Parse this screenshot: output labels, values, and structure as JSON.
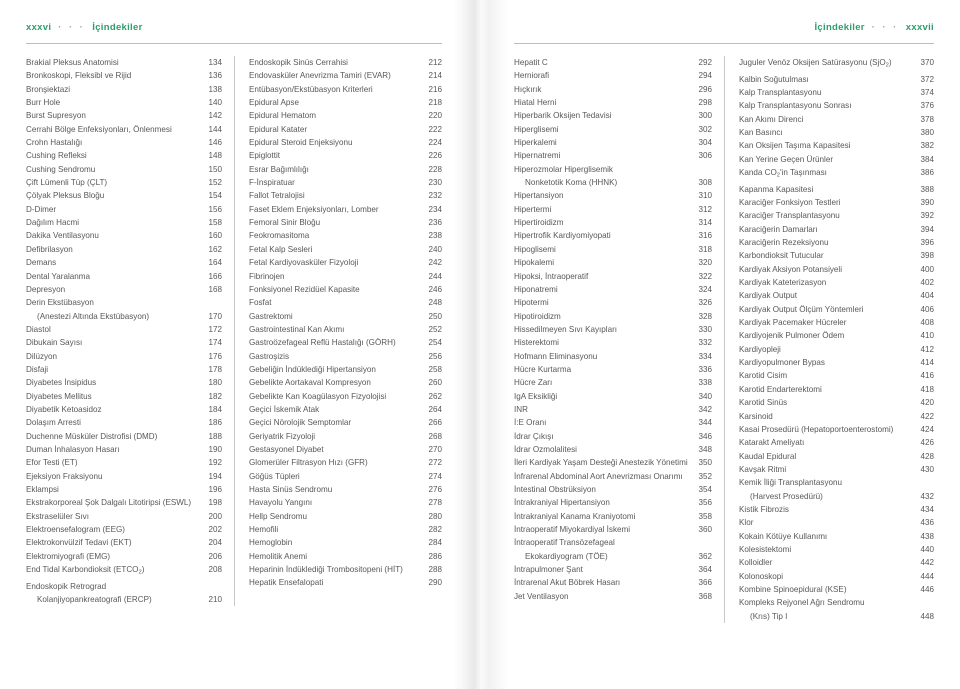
{
  "left_page": {
    "running_head": {
      "folio": "xxxvi",
      "dots": "· · ·",
      "title": "İçindekiler"
    },
    "columns": [
      {
        "entries": [
          {
            "title": "Brakial Pleksus Anatomisi",
            "page": "134"
          },
          {
            "title": "Bronkoskopi, Fleksibl ve Rijid",
            "page": "136"
          },
          {
            "title": "Bronşiektazi",
            "page": "138"
          },
          {
            "title": "Burr Hole",
            "page": "140"
          },
          {
            "title": "Burst Supresyon",
            "page": "142"
          },
          {
            "title": "Cerrahi Bölge Enfeksiyonları, Önlenmesi",
            "page": "144"
          },
          {
            "title": "Crohn Hastalığı",
            "page": "146"
          },
          {
            "title": "Cushing Refleksi",
            "page": "148"
          },
          {
            "title": "Cushing Sendromu",
            "page": "150"
          },
          {
            "title": "Çift Lümenli Tüp (ÇLT)",
            "page": "152"
          },
          {
            "title": "Çölyak Pleksus Bloğu",
            "page": "154"
          },
          {
            "title": "D-Dimer",
            "page": "156"
          },
          {
            "title": "Dağılım Hacmi",
            "page": "158"
          },
          {
            "title": "Dakika Ventilasyonu",
            "page": "160"
          },
          {
            "title": "Defibrilasyon",
            "page": "162"
          },
          {
            "title": "Demans",
            "page": "164"
          },
          {
            "title": "Dental Yaralanma",
            "page": "166"
          },
          {
            "title": "Depresyon",
            "page": "168"
          },
          {
            "title": "Derin Ekstübasyon",
            "page": "",
            "continued": "head"
          },
          {
            "title": "(Anestezi Altında Ekstübasyon)",
            "page": "170",
            "continued": "tail"
          },
          {
            "title": "Diastol",
            "page": "172"
          },
          {
            "title": "Dibukain Sayısı",
            "page": "174"
          },
          {
            "title": "Dilüzyon",
            "page": "176"
          },
          {
            "title": "Disfaji",
            "page": "178"
          },
          {
            "title": "Diyabetes İnsipidus",
            "page": "180"
          },
          {
            "title": "Diyabetes Mellitus",
            "page": "182"
          },
          {
            "title": "Diyabetik Ketoasidoz",
            "page": "184"
          },
          {
            "title": "Dolaşım Arresti",
            "page": "186"
          },
          {
            "title": "Duchenne Müsküler Distrofisi (DMD)",
            "page": "188"
          },
          {
            "title": "Duman İnhalasyon Hasarı",
            "page": "190"
          },
          {
            "title": "Efor Testi (ET)",
            "page": "192"
          },
          {
            "title": "Ejeksiyon Fraksiyonu",
            "page": "194"
          },
          {
            "title": "Eklampsi",
            "page": "196"
          },
          {
            "title": "Ekstrakorporeal Şok Dalgalı Litotiripsi (ESWL)",
            "page": "198"
          },
          {
            "title": "Ekstraselüler Sıvı",
            "page": "200"
          },
          {
            "title": "Elektroensefalogram (EEG)",
            "page": "202"
          },
          {
            "title": "Elektrokonvülzif Tedavi (EKT)",
            "page": "204"
          },
          {
            "title": "Elektromiyografi (EMG)",
            "page": "206"
          },
          {
            "title": "End Tidal Karbondioksit (ETCO2)",
            "title_html": "End Tidal Karbondioksit (ETCO<sub>2</sub>)",
            "page": "208"
          },
          {
            "title": "Endoskopik Retrograd",
            "page": "",
            "continued": "head"
          },
          {
            "title": "Kolanjiyopankreatografi (ERCP)",
            "page": "210",
            "continued": "tail"
          }
        ]
      },
      {
        "entries": [
          {
            "title": "Endoskopik Sinüs Cerrahisi",
            "page": "212"
          },
          {
            "title": "Endovasküler Anevrizma Tamiri (EVAR)",
            "page": "214"
          },
          {
            "title": "Entübasyon/Ekstübasyon Kriterleri",
            "page": "216"
          },
          {
            "title": "Epidural Apse",
            "page": "218"
          },
          {
            "title": "Epidural Hematom",
            "page": "220"
          },
          {
            "title": "Epidural Katater",
            "page": "222"
          },
          {
            "title": "Epidural Steroid Enjeksiyonu",
            "page": "224"
          },
          {
            "title": "Epiglottit",
            "page": "226"
          },
          {
            "title": "Esrar Bağımlılığı",
            "page": "228"
          },
          {
            "title": "F-İnspiratuar",
            "page": "230"
          },
          {
            "title": "Fallot Tetralojisi",
            "page": "232"
          },
          {
            "title": "Faset Eklem Enjeksiyonları, Lomber",
            "page": "234"
          },
          {
            "title": "Femoral Sinir Bloğu",
            "page": "236"
          },
          {
            "title": "Feokromasitoma",
            "page": "238"
          },
          {
            "title": "Fetal Kalp Sesleri",
            "page": "240"
          },
          {
            "title": "Fetal Kardiyovasküler Fizyoloji",
            "page": "242"
          },
          {
            "title": "Fibrinojen",
            "page": "244"
          },
          {
            "title": "Fonksiyonel Rezidüel Kapasite",
            "page": "246"
          },
          {
            "title": "Fosfat",
            "page": "248"
          },
          {
            "title": "Gastrektomi",
            "page": "250"
          },
          {
            "title": "Gastrointestinal Kan Akımı",
            "page": "252"
          },
          {
            "title": "Gastroözefageal Reflü Hastalığı (GÖRH)",
            "page": "254"
          },
          {
            "title": "Gastroşizis",
            "page": "256"
          },
          {
            "title": "Gebeliğin İndüklediği Hipertansiyon",
            "page": "258"
          },
          {
            "title": "Gebelikte Aortakaval Kompresyon",
            "page": "260"
          },
          {
            "title": "Gebelikte Kan Koagülasyon Fizyolojisi",
            "page": "262"
          },
          {
            "title": "Geçici İskemik Atak",
            "page": "264"
          },
          {
            "title": "Geçici Nörolojik Semptomlar",
            "page": "266"
          },
          {
            "title": "Geriyatrik Fizyoloji",
            "page": "268"
          },
          {
            "title": "Gestasyonel Diyabet",
            "page": "270"
          },
          {
            "title": "Glomerüler Filtrasyon Hızı (GFR)",
            "page": "272"
          },
          {
            "title": "Göğüs Tüpleri",
            "page": "274"
          },
          {
            "title": "Hasta Sinüs Sendromu",
            "page": "276"
          },
          {
            "title": "Havayolu Yangını",
            "page": "278"
          },
          {
            "title": "Hellp Sendromu",
            "page": "280"
          },
          {
            "title": "Hemofili",
            "page": "282"
          },
          {
            "title": "Hemoglobin",
            "page": "284"
          },
          {
            "title": "Hemolitik Anemi",
            "page": "286"
          },
          {
            "title": "Heparinin İndüklediği Trombositopeni (HİT)",
            "page": "288"
          },
          {
            "title": "Hepatik Ensefalopati",
            "page": "290"
          }
        ]
      }
    ]
  },
  "right_page": {
    "running_head": {
      "title": "İçindekiler",
      "dots": "· · ·",
      "folio": "xxxvii"
    },
    "columns": [
      {
        "entries": [
          {
            "title": "Hepatit C",
            "page": "292"
          },
          {
            "title": "Herniorafi",
            "page": "294"
          },
          {
            "title": "Hıçkırık",
            "page": "296"
          },
          {
            "title": "Hiatal Herni",
            "page": "298"
          },
          {
            "title": "Hiperbarik Oksijen Tedavisi",
            "page": "300"
          },
          {
            "title": "Hiperglisemi",
            "page": "302"
          },
          {
            "title": "Hiperkalemi",
            "page": "304"
          },
          {
            "title": "Hipernatremi",
            "page": "306"
          },
          {
            "title": "Hiperozmolar Hiperglisemik",
            "page": "",
            "continued": "head"
          },
          {
            "title": "Nonketotik Koma (HHNK)",
            "page": "308",
            "continued": "tail"
          },
          {
            "title": "Hipertansiyon",
            "page": "310"
          },
          {
            "title": "Hipertermi",
            "page": "312"
          },
          {
            "title": "Hipertiroidizm",
            "page": "314"
          },
          {
            "title": "Hipertrofik Kardiyomiyopati",
            "page": "316"
          },
          {
            "title": "Hipoglisemi",
            "page": "318"
          },
          {
            "title": "Hipokalemi",
            "page": "320"
          },
          {
            "title": "Hipoksi, İntraoperatif",
            "page": "322"
          },
          {
            "title": "Hiponatremi",
            "page": "324"
          },
          {
            "title": "Hipotermi",
            "page": "326"
          },
          {
            "title": "Hipotiroidizm",
            "page": "328"
          },
          {
            "title": "Hissedilmeyen Sıvı Kayıpları",
            "page": "330"
          },
          {
            "title": "Histerektomi",
            "page": "332"
          },
          {
            "title": "Hofmann Eliminasyonu",
            "page": "334"
          },
          {
            "title": "Hücre Kurtarma",
            "page": "336"
          },
          {
            "title": "Hücre Zarı",
            "page": "338"
          },
          {
            "title": "IgA Eksikliği",
            "page": "340"
          },
          {
            "title": "INR",
            "page": "342"
          },
          {
            "title": "İ:E Oranı",
            "page": "344"
          },
          {
            "title": "İdrar Çıkışı",
            "page": "346"
          },
          {
            "title": "İdrar Ozmolalitesi",
            "page": "348"
          },
          {
            "title": "İleri Kardiyak Yaşam Desteği Anestezik Yönetimi",
            "page": "350"
          },
          {
            "title": "İnfrarenal Abdominal Aort Anevrizması Onarımı",
            "page": "352"
          },
          {
            "title": "İntestinal Obstrüksiyon",
            "page": "354"
          },
          {
            "title": "İntrakraniyal Hipertansiyon",
            "page": "356"
          },
          {
            "title": "İntrakraniyal Kanama Kraniyotomi",
            "page": "358"
          },
          {
            "title": "İntraoperatif Miyokardiyal İskemi",
            "page": "360"
          },
          {
            "title": "İntraoperatif Transözefageal",
            "page": "",
            "continued": "head"
          },
          {
            "title": "Ekokardiyogram (TÖE)",
            "page": "362",
            "continued": "tail"
          },
          {
            "title": "İntrapulmoner Şant",
            "page": "364"
          },
          {
            "title": "İntrarenal Akut Böbrek Hasarı",
            "page": "366"
          },
          {
            "title": "Jet Ventilasyon",
            "page": "368"
          }
        ]
      },
      {
        "entries": [
          {
            "title": "Juguler Venöz Oksijen Satürasyonu (SjO2)",
            "title_html": "Juguler Venöz Oksijen Satürasyonu (SjO<sub>2</sub>)",
            "page": "370"
          },
          {
            "title": "Kalbin Soğutulması",
            "page": "372"
          },
          {
            "title": "Kalp Transplantasyonu",
            "page": "374"
          },
          {
            "title": "Kalp Transplantasyonu Sonrası",
            "page": "376"
          },
          {
            "title": "Kan Akımı Direnci",
            "page": "378"
          },
          {
            "title": "Kan Basıncı",
            "page": "380"
          },
          {
            "title": "Kan Oksijen Taşıma Kapasitesi",
            "page": "382"
          },
          {
            "title": "Kan Yerine Geçen Ürünler",
            "page": "384"
          },
          {
            "title": "Kanda CO2'in Taşınması",
            "title_html": "Kanda CO<sub>2</sub>'in Taşınması",
            "page": "386"
          },
          {
            "title": "Kapanma Kapasitesi",
            "page": "388"
          },
          {
            "title": "Karaciğer Fonksiyon Testleri",
            "page": "390"
          },
          {
            "title": "Karaciğer Transplantasyonu",
            "page": "392"
          },
          {
            "title": "Karaciğerin Damarları",
            "page": "394"
          },
          {
            "title": "Karaciğerin Rezeksiyonu",
            "page": "396"
          },
          {
            "title": "Karbondioksit Tutucular",
            "page": "398"
          },
          {
            "title": "Kardiyak Aksiyon Potansiyeli",
            "page": "400"
          },
          {
            "title": "Kardiyak Kateterizasyon",
            "page": "402"
          },
          {
            "title": "Kardiyak Output",
            "page": "404"
          },
          {
            "title": "Kardiyak Output Ölçüm Yöntemleri",
            "page": "406"
          },
          {
            "title": "Kardiyak Pacemaker Hücreler",
            "page": "408"
          },
          {
            "title": "Kardiyojenik Pulmoner Ödem",
            "page": "410"
          },
          {
            "title": "Kardiyopleji",
            "page": "412"
          },
          {
            "title": "Kardiyopulmoner Bypas",
            "page": "414"
          },
          {
            "title": "Karotid Cisim",
            "page": "416"
          },
          {
            "title": "Karotid Endarterektomi",
            "page": "418"
          },
          {
            "title": "Karotid Sinüs",
            "page": "420"
          },
          {
            "title": "Karsinoid",
            "page": "422"
          },
          {
            "title": "Kasai Prosedürü (Hepatoportoenterostomi)",
            "page": "424"
          },
          {
            "title": "Katarakt Ameliyatı",
            "page": "426"
          },
          {
            "title": "Kaudal Epidural",
            "page": "428"
          },
          {
            "title": "Kavşak Ritmi",
            "page": "430"
          },
          {
            "title": "Kemik İliği Transplantasyonu",
            "page": "",
            "continued": "head"
          },
          {
            "title": "(Harvest Prosedürü)",
            "page": "432",
            "continued": "tail"
          },
          {
            "title": "Kistik Fibrozis",
            "page": "434"
          },
          {
            "title": "Klor",
            "page": "436"
          },
          {
            "title": "Kokain Kötüye Kullanımı",
            "page": "438"
          },
          {
            "title": "Kolesistektomi",
            "page": "440"
          },
          {
            "title": "Kolloidler",
            "page": "442"
          },
          {
            "title": "Kolonoskopi",
            "page": "444"
          },
          {
            "title": "Kombine Spinoepidural (KSE)",
            "page": "446"
          },
          {
            "title": "Kompleks Rejyonel Ağrı Sendromu",
            "page": "",
            "continued": "head"
          },
          {
            "title": "(Krıs) Tip I",
            "page": "448",
            "continued": "tail"
          }
        ]
      }
    ]
  },
  "colors": {
    "heading_green": "#2f9c6e",
    "body_gray": "#58585a",
    "rule_gray": "#bdbdbd"
  }
}
